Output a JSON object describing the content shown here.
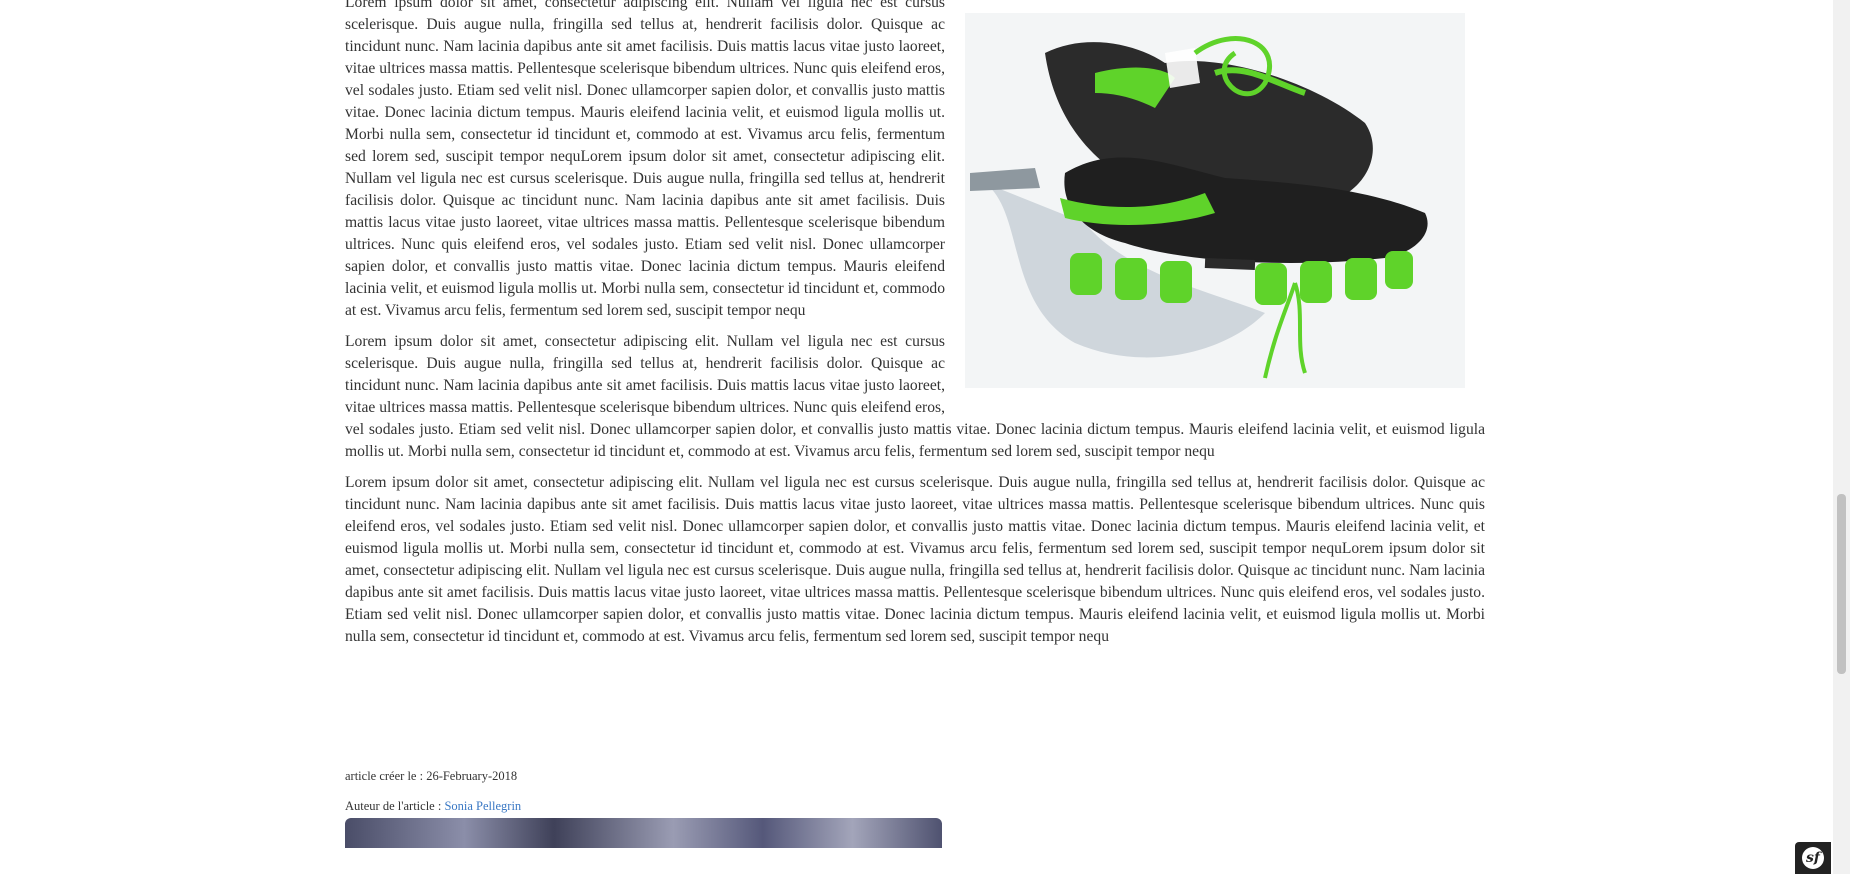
{
  "article": {
    "paragraphs": [
      "Lorem ipsum dolor sit amet, consectetur adipiscing elit. Nullam vel ligula nec est cursus scelerisque. Duis augue nulla, fringilla sed tellus at, hendrerit facilisis dolor. Quisque ac tincidunt nunc. Nam lacinia dapibus ante sit amet facilisis. Duis mattis lacus vitae justo laoreet, vitae ultrices massa mattis. Pellentesque scelerisque bibendum ultrices. Nunc quis eleifend eros, vel sodales justo. Etiam sed velit nisl. Donec ullamcorper sapien dolor, et convallis justo mattis vitae. Donec lacinia dictum tempus. Mauris eleifend lacinia velit, et euismod ligula mollis ut. Morbi nulla sem, consectetur id tincidunt et, commodo at est. Vivamus arcu felis, fermentum sed lorem sed, suscipit tempor nequLorem ipsum dolor sit amet, consectetur adipiscing elit. Nullam vel ligula nec est cursus scelerisque. Duis augue nulla, fringilla sed tellus at, hendrerit facilisis dolor. Quisque ac tincidunt nunc. Nam lacinia dapibus ante sit amet facilisis. Duis mattis lacus vitae justo laoreet, vitae ultrices massa mattis. Pellentesque scelerisque bibendum ultrices. Nunc quis eleifend eros, vel sodales justo. Etiam sed velit nisl. Donec ullamcorper sapien dolor, et convallis justo mattis vitae. Donec lacinia dictum tempus. Mauris eleifend lacinia velit, et euismod ligula mollis ut. Morbi nulla sem, consectetur id tincidunt et, commodo at est. Vivamus arcu felis, fermentum sed lorem sed, suscipit tempor nequ",
      "Lorem ipsum dolor sit amet, consectetur adipiscing elit. Nullam vel ligula nec est cursus scelerisque. Duis augue nulla, fringilla sed tellus at, hendrerit facilisis dolor. Quisque ac tincidunt nunc. Nam lacinia dapibus ante sit amet facilisis. Duis mattis lacus vitae justo laoreet, vitae ultrices massa mattis. Pellentesque scelerisque bibendum ultrices. Nunc quis eleifend eros, vel sodales justo. Etiam sed velit nisl. Donec ullamcorper sapien dolor, et convallis justo mattis vitae. Donec lacinia dictum tempus. Mauris eleifend lacinia velit, et euismod ligula mollis ut. Morbi nulla sem, consectetur id tincidunt et, commodo at est. Vivamus arcu felis, fermentum sed lorem sed, suscipit tempor nequ",
      "Lorem ipsum dolor sit amet, consectetur adipiscing elit. Nullam vel ligula nec est cursus scelerisque. Duis augue nulla, fringilla sed tellus at, hendrerit facilisis dolor. Quisque ac tincidunt nunc. Nam lacinia dapibus ante sit amet facilisis. Duis mattis lacus vitae justo laoreet, vitae ultrices massa mattis. Pellentesque scelerisque bibendum ultrices. Nunc quis eleifend eros, vel sodales justo. Etiam sed velit nisl. Donec ullamcorper sapien dolor, et convallis justo mattis vitae. Donec lacinia dictum tempus. Mauris eleifend lacinia velit, et euismod ligula mollis ut. Morbi nulla sem, consectetur id tincidunt et, commodo at est. Vivamus arcu felis, fermentum sed lorem sed, suscipit tempor nequLorem ipsum dolor sit amet, consectetur adipiscing elit. Nullam vel ligula nec est cursus scelerisque. Duis augue nulla, fringilla sed tellus at, hendrerit facilisis dolor. Quisque ac tincidunt nunc. Nam lacinia dapibus ante sit amet facilisis. Duis mattis lacus vitae justo laoreet, vitae ultrices massa mattis. Pellentesque scelerisque bibendum ultrices. Nunc quis eleifend eros, vel sodales justo. Etiam sed velit nisl. Donec ullamcorper sapien dolor, et convallis justo mattis vitae. Donec lacinia dictum tempus. Mauris eleifend lacinia velit, et euismod ligula mollis ut. Morbi nulla sem, consectetur id tincidunt et, commodo at est. Vivamus arcu felis, fermentum sed lorem sed, suscipit tempor nequ"
    ],
    "image": {
      "icon": "shoes-photo",
      "shoe_color": "#2b2b2b",
      "accent_color": "#5fd32a"
    },
    "created_label": "article créer le : 26-February-2018",
    "author_label": "Auteur de l'article : ",
    "author_name": "Sonia Pellegrin",
    "link_color": "#3a78c4"
  },
  "toolbar": {
    "icon": "symfony-logo-icon",
    "logo_glyph": "sf"
  }
}
